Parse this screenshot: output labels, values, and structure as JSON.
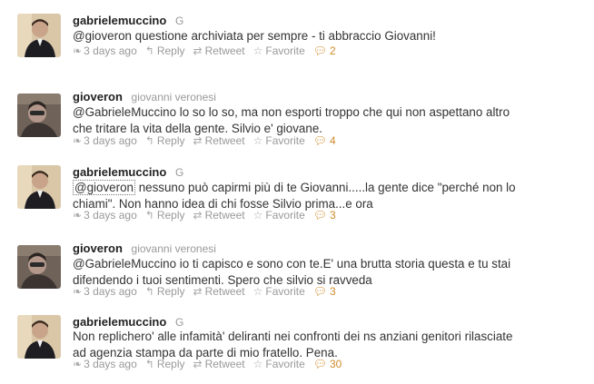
{
  "tweets": [
    {
      "username": "gabrielemuccino",
      "fullname": "G",
      "avatar": "gabrielemuccino",
      "lines": [
        "@gioveron questione archiviata per sempre - ti abbraccio Giovanni!"
      ],
      "time": "3 days ago",
      "reply": "Reply",
      "retweet": "Retweet",
      "favorite": "Favorite",
      "replies": "2"
    },
    {
      "username": "gioveron",
      "fullname": "giovanni veronesi",
      "avatar": "gioveron",
      "lines": [
        "@GabrieleMuccino lo so lo so, ma non esporti troppo che qui non aspettano altro",
        "che tritare la vita della gente. Silvio e' giovane."
      ],
      "time": "3 days ago",
      "reply": "Reply",
      "retweet": "Retweet",
      "favorite": "Favorite",
      "replies": "4"
    },
    {
      "username": "gabrielemuccino",
      "fullname": "G",
      "avatar": "gabrielemuccino",
      "mention": "@gioveron",
      "lines": [
        " nessuno può capirmi più di te Giovanni.....la gente dice \"perché non lo",
        "chiami\". Non hanno idea di chi fosse Silvio prima...e ora"
      ],
      "time": "3 days ago",
      "reply": "Reply",
      "retweet": "Retweet",
      "favorite": "Favorite",
      "replies": "3"
    },
    {
      "username": "gioveron",
      "fullname": "giovanni veronesi",
      "avatar": "gioveron",
      "lines": [
        "@GabrieleMuccino io ti capisco e sono con te.E' una brutta storia questa e tu stai",
        "difendendo i tuoi sentimenti. Spero che silvio si ravveda"
      ],
      "time": "3 days ago",
      "reply": "Reply",
      "retweet": "Retweet",
      "favorite": "Favorite",
      "replies": "3"
    },
    {
      "username": "gabrielemuccino",
      "fullname": "G",
      "avatar": "gabrielemuccino",
      "lines": [
        "Non replichero' alle infamità' deliranti nei confronti dei ns anziani genitori rilasciate",
        "ad agenzia stampa da parte di mio fratello. Pena."
      ],
      "time": "3 days ago",
      "reply": "Reply",
      "retweet": "Retweet",
      "favorite": "Favorite",
      "replies": "30"
    }
  ],
  "colors": {
    "username": "#222222",
    "meta": "#999999",
    "reply_count": "#d08a2b"
  }
}
